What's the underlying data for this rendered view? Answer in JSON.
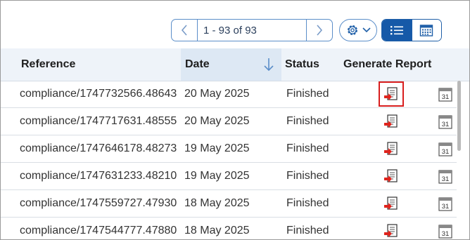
{
  "pagination": {
    "range_text": "1 - 93 of 93",
    "prev_icon": "chevron-left-icon",
    "next_icon": "chevron-right-icon"
  },
  "toolbar": {
    "settings_icon": "gear-icon",
    "list_view_icon": "list-view-icon",
    "calendar_view_icon": "calendar-view-icon",
    "active_view": "list"
  },
  "table": {
    "columns": {
      "reference": "Reference",
      "date": "Date",
      "status": "Status",
      "generate_report": "Generate Report"
    },
    "sort": {
      "column": "date",
      "direction": "descending"
    },
    "rows": [
      {
        "reference": "compliance/1747732566.48643",
        "date": "20 May 2025",
        "status": "Finished",
        "calendar": "31"
      },
      {
        "reference": "compliance/1747717631.48555",
        "date": "20 May 2025",
        "status": "Finished",
        "calendar": "31"
      },
      {
        "reference": "compliance/1747646178.48273",
        "date": "19 May 2025",
        "status": "Finished",
        "calendar": "31"
      },
      {
        "reference": "compliance/1747631233.48210",
        "date": "19 May 2025",
        "status": "Finished",
        "calendar": "31"
      },
      {
        "reference": "compliance/1747559727.47930",
        "date": "18 May 2025",
        "status": "Finished",
        "calendar": "31"
      },
      {
        "reference": "compliance/1747544777.47880",
        "date": "18 May 2025",
        "status": "Finished",
        "calendar": "31"
      }
    ]
  },
  "colors": {
    "accent": "#1659a8",
    "highlight": "#d81e1e",
    "header_bg": "#eef3f9"
  }
}
